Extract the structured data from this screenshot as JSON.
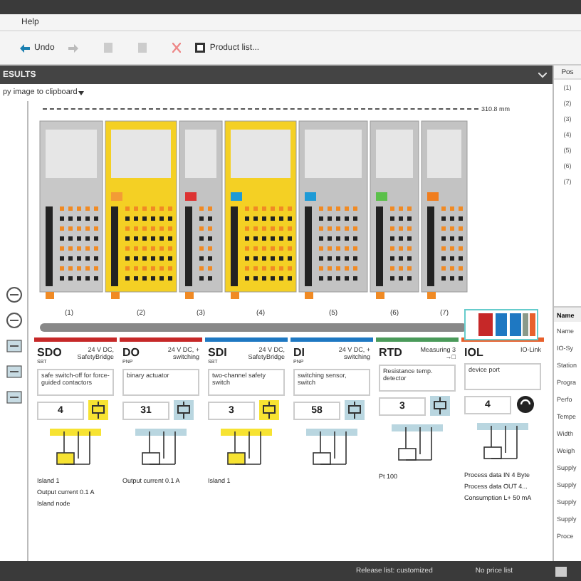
{
  "menu": [
    "Help"
  ],
  "toolbar": [
    {
      "label": "Undo",
      "kind": "undo"
    },
    {
      "label": "Product list...",
      "kind": "list"
    }
  ],
  "results_header": "ESULTS",
  "copy_link": "py image to clipboard",
  "dimension": "310.8 mm",
  "module_labels": [
    "(1)",
    "(2)",
    "(3)",
    "(4)",
    "(5)",
    "(6)",
    "(7)"
  ],
  "cards": [
    {
      "type": "SDO",
      "sub": "SBT",
      "spec": "24 V DC, SafetyBridge",
      "desc": "safe switch-off for force-guided contactors",
      "count": "4",
      "kind": "safety",
      "color": "#c62828",
      "notes": [
        "Island 1",
        "Output current 0.1 A",
        "Island node"
      ]
    },
    {
      "type": "DO",
      "sub": "PNP",
      "spec": "24 V DC, + switching",
      "desc": "binary actuator",
      "count": "31",
      "kind": "standard",
      "color": "#c62828",
      "notes": [
        "Output current 0.1 A"
      ]
    },
    {
      "type": "SDI",
      "sub": "SBT",
      "spec": "24 V DC, SafetyBridge",
      "desc": "two-channel safety switch",
      "count": "3",
      "kind": "safety",
      "color": "#1e78c2",
      "notes": [
        "Island 1"
      ]
    },
    {
      "type": "DI",
      "sub": "PNP",
      "spec": "24 V DC, + switching",
      "desc": "switching sensor, switch",
      "count": "58",
      "kind": "standard",
      "color": "#1e78c2"
    },
    {
      "type": "RTD",
      "spec": "Measuring 3 →□",
      "desc": "Resistance temp. detector",
      "count": "3",
      "kind": "standard",
      "color": "#4a9a5a",
      "notes": [
        "Pt 100"
      ]
    },
    {
      "type": "IOL",
      "spec": "IO-Link",
      "desc": "device port",
      "count": "4",
      "kind": "iolink",
      "color": "#e8602c",
      "notes": [
        "Process data IN 4 Byte",
        "Process data OUT 4...",
        "Consumption L+ 50 mA"
      ]
    }
  ],
  "position_list": {
    "header": "Pos",
    "items": [
      "(1)",
      "(2)",
      "(3)",
      "(4)",
      "(5)",
      "(6)",
      "(7)"
    ]
  },
  "properties": {
    "header": "Name",
    "rows": [
      "Name",
      "IO-Sy",
      "Station",
      "Progra",
      "Perfo",
      "Tempe",
      "Width",
      "Weigh",
      "Supply",
      "Supply",
      "Supply",
      "Supply",
      "Proce"
    ]
  },
  "status": [
    "Release list: customized",
    "No price list"
  ]
}
